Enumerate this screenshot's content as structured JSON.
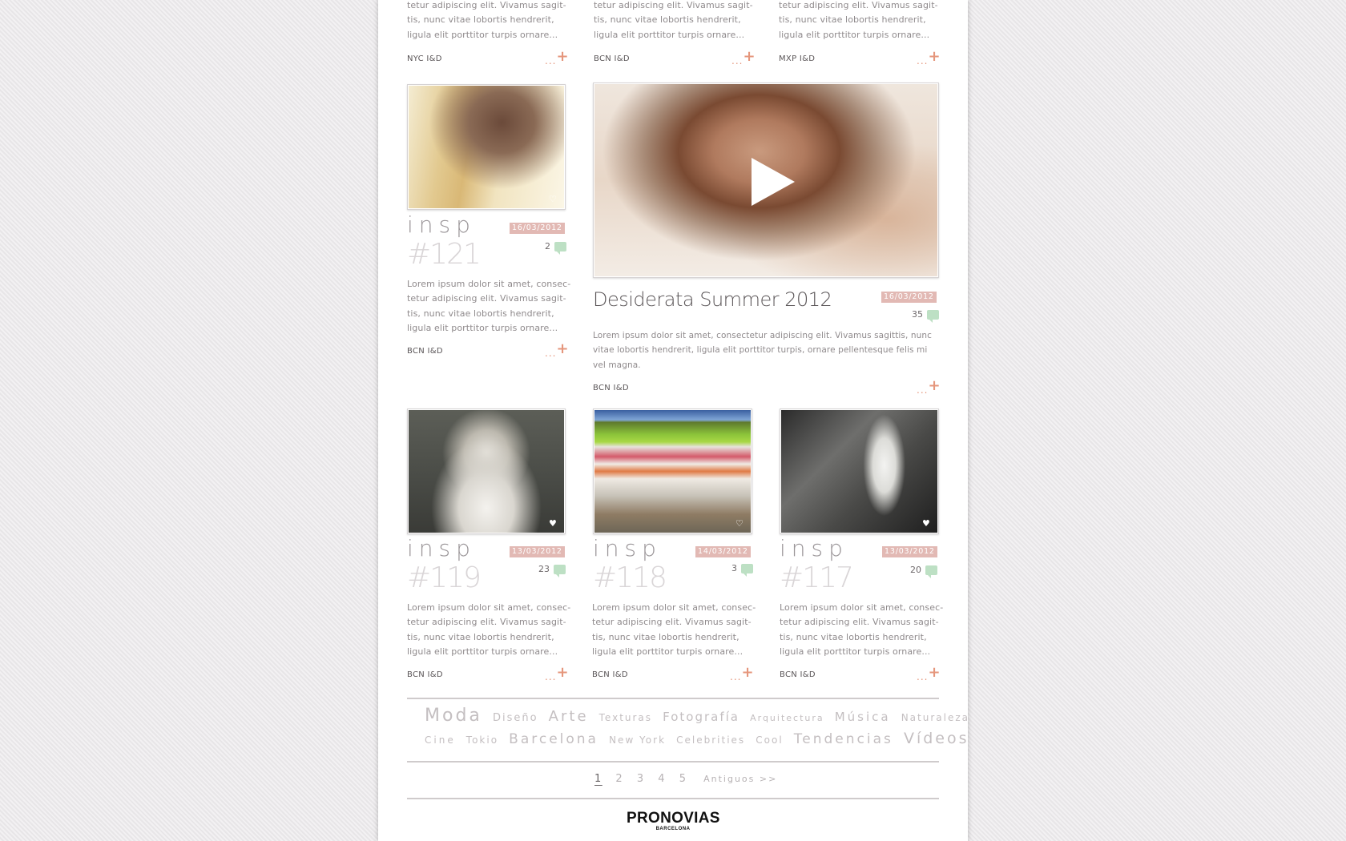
{
  "brand": {
    "name": "PRONOVIAS",
    "sub": "BARCELONA"
  },
  "colors": {
    "accent": "#e5967c",
    "date_badge": "#e2b9b4",
    "comment_bubble": "#bde0c4"
  },
  "excerpt_lines": [
    "Lorem ipsum dolor sit amet, consec-",
    "tetur adipiscing elit. Vivamus sagit-",
    "tis, nunc vitae lobortis hendrerit,",
    "ligula elit porttitor turpis ornare..."
  ],
  "more_label": "...",
  "more_icon": "plus-icon",
  "top_row": [
    {
      "lines": [
        "tetur adipiscing elit. Vivamus sagit-",
        "tis, nunc vitae lobortis hendrerit,",
        "ligula elit porttitor turpis ornare..."
      ],
      "location": "NYC I&D"
    },
    {
      "lines": [
        "tetur adipiscing elit. Vivamus sagit-",
        "tis, nunc vitae lobortis hendrerit,",
        "ligula elit porttitor turpis ornare..."
      ],
      "location": "BCN I&D"
    },
    {
      "lines": [
        "tetur adipiscing elit. Vivamus sagit-",
        "tis, nunc vitae lobortis hendrerit,",
        "ligula elit porttitor turpis ornare..."
      ],
      "location": "MXP I&D"
    }
  ],
  "posts": {
    "p121": {
      "kind": "insp",
      "number": "#121",
      "date": "16/03/2012",
      "comments": "2",
      "location": "BCN I&D"
    },
    "p119": {
      "kind": "insp",
      "number": "#119",
      "date": "13/03/2012",
      "comments": "23",
      "location": "BCN I&D"
    },
    "p118": {
      "kind": "insp",
      "number": "#118",
      "date": "14/03/2012",
      "comments": "3",
      "location": "BCN I&D"
    },
    "p117": {
      "kind": "insp",
      "number": "#117",
      "date": "13/03/2012",
      "comments": "20",
      "location": "BCN I&D"
    }
  },
  "featured": {
    "title": "Desiderata Summer 2012",
    "date": "16/03/2012",
    "comments": "35",
    "lines": [
      "Lorem ipsum dolor sit amet, consectetur adipiscing elit. Vivamus sagittis, nunc",
      "vitae lobortis hendrerit, ligula elit porttitor turpis, ornare pellentesque felis mi",
      "vel magna."
    ],
    "location": "BCN I&D"
  },
  "tags": [
    "Moda",
    "Diseño",
    "Arte",
    "Texturas",
    "Fotografía",
    "Arquitectura",
    "Música",
    "Naturaleza",
    "Cine",
    "Tokio",
    "Barcelona",
    "New York",
    "Celebrities",
    "Cool",
    "Tendencias",
    "Vídeos"
  ],
  "pagination": {
    "pages": [
      "1",
      "2",
      "3",
      "4",
      "5"
    ],
    "current": "1",
    "older": "Antiguos >>"
  }
}
